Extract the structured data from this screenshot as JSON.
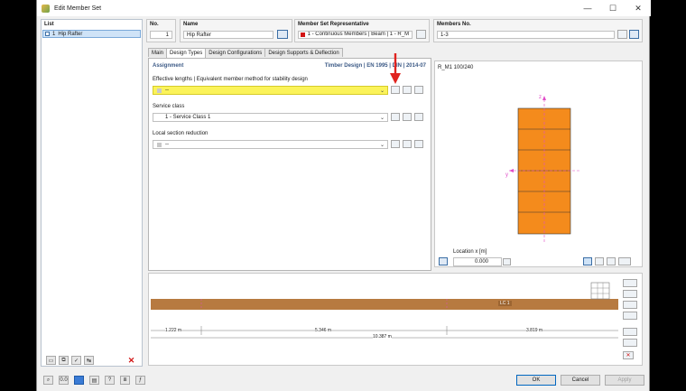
{
  "window": {
    "title": "Edit Member Set",
    "controls": [
      "—",
      "☐",
      "✕"
    ]
  },
  "list": {
    "header": "List",
    "items": [
      {
        "no": "1",
        "label": "Hip Rafter"
      }
    ]
  },
  "header": {
    "no_label": "No.",
    "no_value": "1",
    "name_label": "Name",
    "name_value": "Hip Rafter",
    "rep_label": "Member Set Representative",
    "rep_value": "1 - Continuous Members | Beam | 1 - R_M1 ...",
    "members_label": "Members No.",
    "members_value": "1-3"
  },
  "tabs": [
    "Main",
    "Design Types",
    "Design Configurations",
    "Design Supports & Deflection"
  ],
  "active_tab": "Design Types",
  "assignment": {
    "title": "Assignment",
    "standard": "Timber Design | EN 1995 | DIN | 2014-07",
    "eff_label": "Effective lengths | Equivalent member method for stability design",
    "eff_value": "--",
    "service_label": "Service class",
    "service_value": "1 - Service Class 1",
    "local_label": "Local section reduction",
    "local_value": "--"
  },
  "section": {
    "title": "R_M1 100/240",
    "axis_z": "z",
    "axis_y": "y",
    "location_label": "Location x [m]",
    "location_value": "0.000"
  },
  "member_view": {
    "label": "LC 1",
    "dims": [
      "1.222 m",
      "5.346 m",
      "3.819 m"
    ],
    "total": "10.387 m"
  },
  "footer": {
    "ok": "OK",
    "cancel": "Cancel",
    "apply": "Apply"
  },
  "colors": {
    "accent": "#0067c0",
    "section_fill": "#f48b1c",
    "member_fill": "#b77a40",
    "highlight": "#fbf35a",
    "arrow": "#e0231f",
    "axis": "#e04cc8"
  }
}
